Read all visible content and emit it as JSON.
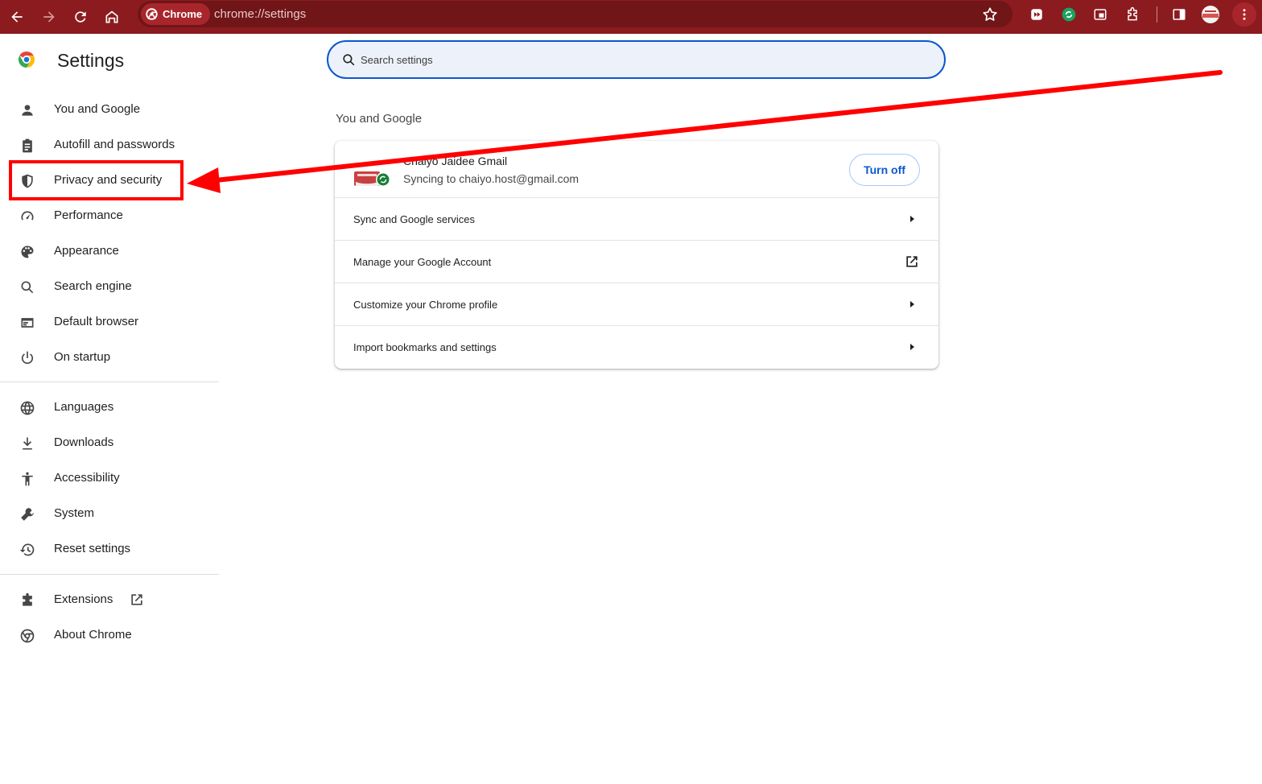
{
  "browser": {
    "chip_label": "Chrome",
    "url": "chrome://settings"
  },
  "sidebar": {
    "title": "Settings",
    "items": [
      {
        "label": "You and Google"
      },
      {
        "label": "Autofill and passwords"
      },
      {
        "label": "Privacy and security"
      },
      {
        "label": "Performance"
      },
      {
        "label": "Appearance"
      },
      {
        "label": "Search engine"
      },
      {
        "label": "Default browser"
      },
      {
        "label": "On startup"
      },
      {
        "label": "Languages"
      },
      {
        "label": "Downloads"
      },
      {
        "label": "Accessibility"
      },
      {
        "label": "System"
      },
      {
        "label": "Reset settings"
      },
      {
        "label": "Extensions"
      },
      {
        "label": "About Chrome"
      }
    ]
  },
  "search": {
    "placeholder": "Search settings"
  },
  "main": {
    "section_heading": "You and Google",
    "profile": {
      "name": "Chaiyo Jaidee Gmail",
      "sync_status": "Syncing to chaiyo.host@gmail.com",
      "turn_off_label": "Turn off"
    },
    "rows": [
      {
        "label": "Sync and Google services",
        "icon": "arrow-right-icon"
      },
      {
        "label": "Manage your Google Account",
        "icon": "external-link-icon"
      },
      {
        "label": "Customize your Chrome profile",
        "icon": "arrow-right-icon"
      },
      {
        "label": "Import bookmarks and settings",
        "icon": "arrow-right-icon"
      }
    ]
  },
  "colors": {
    "toolbar": "#8c1b1f",
    "accent": "#0b57d0",
    "annotation": "#ff0000"
  }
}
